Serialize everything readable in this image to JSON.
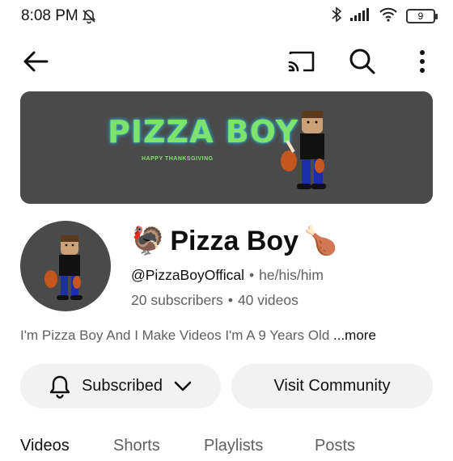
{
  "status_bar": {
    "time": "8:08 PM",
    "battery_level": "9",
    "icons": [
      "dnd-off-icon",
      "bluetooth-icon",
      "signal-icon",
      "wifi-icon",
      "battery-icon"
    ]
  },
  "top_bar": {
    "icons": [
      "back-arrow-icon",
      "cast-icon",
      "search-icon",
      "more-vert-icon"
    ]
  },
  "banner": {
    "title": "PIZZA BOY",
    "subtitle": "HAPPY THANKSGIVING"
  },
  "channel": {
    "name": "Pizza Boy",
    "name_prefix_emoji": "🦃",
    "name_suffix_emoji": "🍗",
    "handle": "@PizzaBoyOffical",
    "pronouns": "he/his/him",
    "subscribers": "20 subscribers",
    "videos": "40 videos",
    "separator": "•",
    "description": "I'm Pizza Boy And I Make Videos I'm A 9 Years Old",
    "more_label": "...more"
  },
  "actions": {
    "subscribed_label": "Subscribed",
    "community_label": "Visit Community"
  },
  "tabs": [
    {
      "label": "Videos",
      "active": true
    },
    {
      "label": "Shorts",
      "active": false
    },
    {
      "label": "Playlists",
      "active": false
    },
    {
      "label": "Posts",
      "active": false
    }
  ],
  "colors": {
    "banner_bg": "#4a4a4a",
    "banner_title": "#7ee36a",
    "button_bg": "#f2f2f2"
  }
}
